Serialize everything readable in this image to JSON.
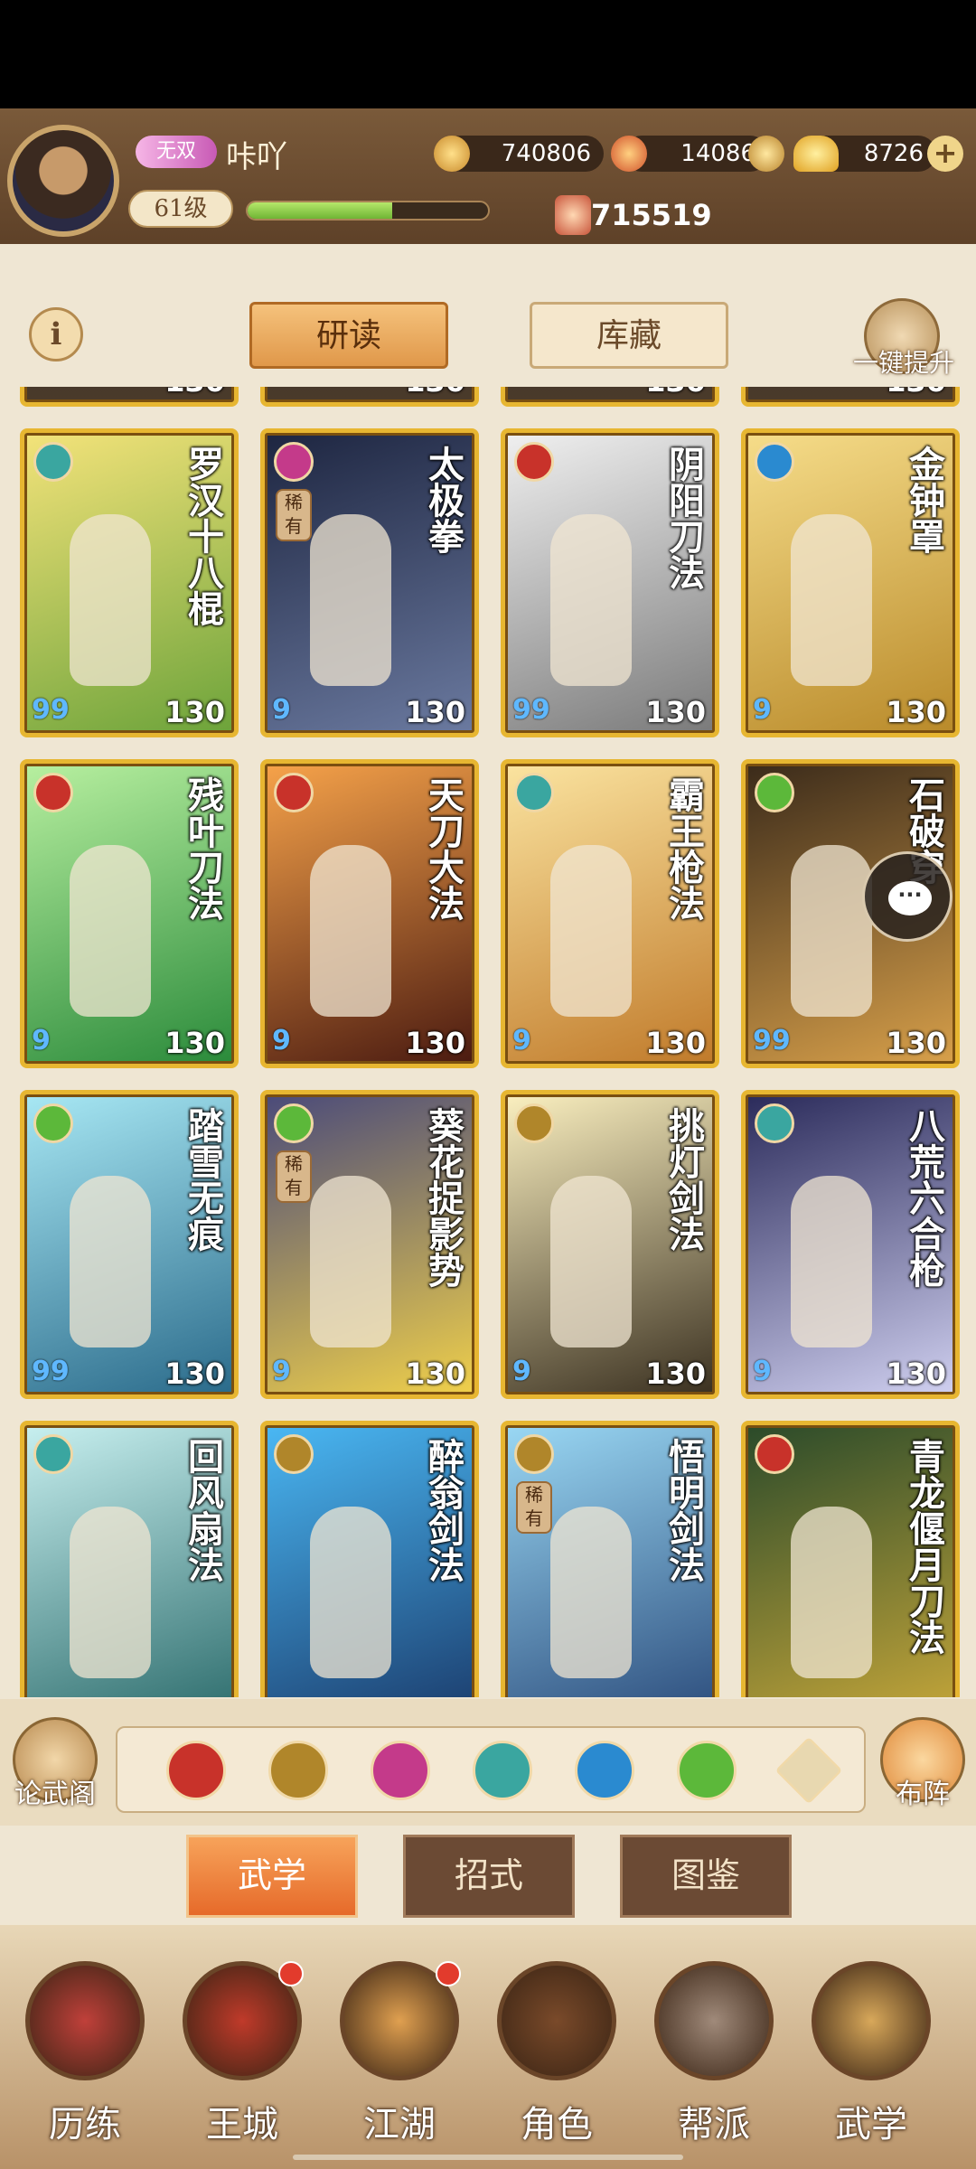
{
  "header": {
    "rank_badge": "无双",
    "player_name": "咔吖",
    "level": "61级",
    "exp_fraction": 0.6,
    "coins": "740806",
    "stamina": "14086",
    "gold": "8726",
    "power": "715519"
  },
  "tabs": {
    "study": "研读",
    "storage": "库藏",
    "one_key_upgrade": "一键提升",
    "info": "i"
  },
  "partial_row": {
    "levels": [
      "130",
      "130",
      "130",
      "130"
    ]
  },
  "cards": [
    {
      "name": "罗汉十八棍",
      "element": "fan",
      "element_color": "#3aa6a0",
      "pips": "99",
      "level": "130",
      "rare": "",
      "bg": [
        "#f4e37a",
        "#6ca33a"
      ]
    },
    {
      "name": "太极拳",
      "element": "fist",
      "element_color": "#c43a8a",
      "pips": "9",
      "level": "130",
      "rare": "稀有",
      "bg": [
        "#1d2540",
        "#6b7aa0"
      ]
    },
    {
      "name": "阴阳刀法",
      "element": "blade",
      "element_color": "#c8322a",
      "pips": "99",
      "level": "130",
      "rare": "",
      "bg": [
        "#f0f0f0",
        "#7a7a7a"
      ]
    },
    {
      "name": "金钟罩",
      "element": "swirl",
      "element_color": "#2a8ad0",
      "pips": "9",
      "level": "130",
      "rare": "",
      "bg": [
        "#f6dd8a",
        "#b98a2a"
      ]
    },
    {
      "name": "残叶刀法",
      "element": "blade",
      "element_color": "#c8322a",
      "pips": "9",
      "level": "130",
      "rare": "",
      "bg": [
        "#b8f0a0",
        "#2a8a3a"
      ]
    },
    {
      "name": "天刀大法",
      "element": "blade",
      "element_color": "#c8322a",
      "pips": "9",
      "level": "130",
      "rare": "",
      "bg": [
        "#f7a34a",
        "#4a1a10"
      ]
    },
    {
      "name": "霸王枪法",
      "element": "fan",
      "element_color": "#3aa6a0",
      "pips": "9",
      "level": "130",
      "rare": "",
      "bg": [
        "#fbe4a0",
        "#c07a2a"
      ]
    },
    {
      "name": "石破穿",
      "element": "leaf",
      "element_color": "#5cb83a",
      "pips": "99",
      "level": "130",
      "rare": "",
      "bg": [
        "#3a2a1a",
        "#d8a04a"
      ]
    },
    {
      "name": "踏雪无痕",
      "element": "leaf",
      "element_color": "#5cb83a",
      "pips": "99",
      "level": "130",
      "rare": "",
      "bg": [
        "#a8e8f4",
        "#2a6a8a"
      ]
    },
    {
      "name": "葵花捉影势",
      "element": "leaf",
      "element_color": "#5cb83a",
      "pips": "9",
      "level": "130",
      "rare": "稀有",
      "bg": [
        "#4a4a7a",
        "#f0d04a"
      ]
    },
    {
      "name": "挑灯剑法",
      "element": "sword",
      "element_color": "#b0862a",
      "pips": "9",
      "level": "130",
      "rare": "",
      "bg": [
        "#fbf0c0",
        "#3a3020"
      ]
    },
    {
      "name": "八荒六合枪",
      "element": "fan",
      "element_color": "#3aa6a0",
      "pips": "9",
      "level": "130",
      "rare": "",
      "bg": [
        "#2a2a5a",
        "#d0d0f0"
      ]
    },
    {
      "name": "回风扇法",
      "element": "fan",
      "element_color": "#3aa6a0",
      "pips": "",
      "level": "",
      "rare": "",
      "bg": [
        "#c8f0f0",
        "#2a6a6a"
      ]
    },
    {
      "name": "醉翁剑法",
      "element": "sword",
      "element_color": "#b0862a",
      "pips": "",
      "level": "",
      "rare": "",
      "bg": [
        "#4ab8f4",
        "#1a3a6a"
      ]
    },
    {
      "name": "悟明剑法",
      "element": "sword",
      "element_color": "#b0862a",
      "pips": "",
      "level": "",
      "rare": "稀有",
      "bg": [
        "#9ad8f4",
        "#2a4a7a"
      ]
    },
    {
      "name": "青龙偃月刀法",
      "element": "blade",
      "element_color": "#c8322a",
      "pips": "",
      "level": "",
      "rare": "",
      "bg": [
        "#2a4a2a",
        "#c8a83a"
      ]
    }
  ],
  "filter": {
    "left_label": "论武阁",
    "right_label": "布阵",
    "icons": [
      {
        "name": "blade-filter-icon",
        "color": "#c8322a"
      },
      {
        "name": "sword-filter-icon",
        "color": "#b0862a"
      },
      {
        "name": "fist-filter-icon",
        "color": "#c43a8a"
      },
      {
        "name": "fan-filter-icon",
        "color": "#3aa6a0"
      },
      {
        "name": "swirl-filter-icon",
        "color": "#2a8ad0"
      },
      {
        "name": "leaf-filter-icon",
        "color": "#5cb83a"
      },
      {
        "name": "rank-filter-icon",
        "color": "#e8d8b0"
      }
    ]
  },
  "subtabs": {
    "martial": "武学",
    "moves": "招式",
    "atlas": "图鉴"
  },
  "nav": [
    {
      "label": "历练",
      "badge": false,
      "color": "#c0403a"
    },
    {
      "label": "王城",
      "badge": true,
      "color": "#c03a2a"
    },
    {
      "label": "江湖",
      "badge": true,
      "color": "#e0a050"
    },
    {
      "label": "角色",
      "badge": false,
      "color": "#7a4a2a"
    },
    {
      "label": "帮派",
      "badge": false,
      "color": "#a08a7a"
    },
    {
      "label": "武学",
      "badge": false,
      "color": "#d8a85a"
    }
  ]
}
